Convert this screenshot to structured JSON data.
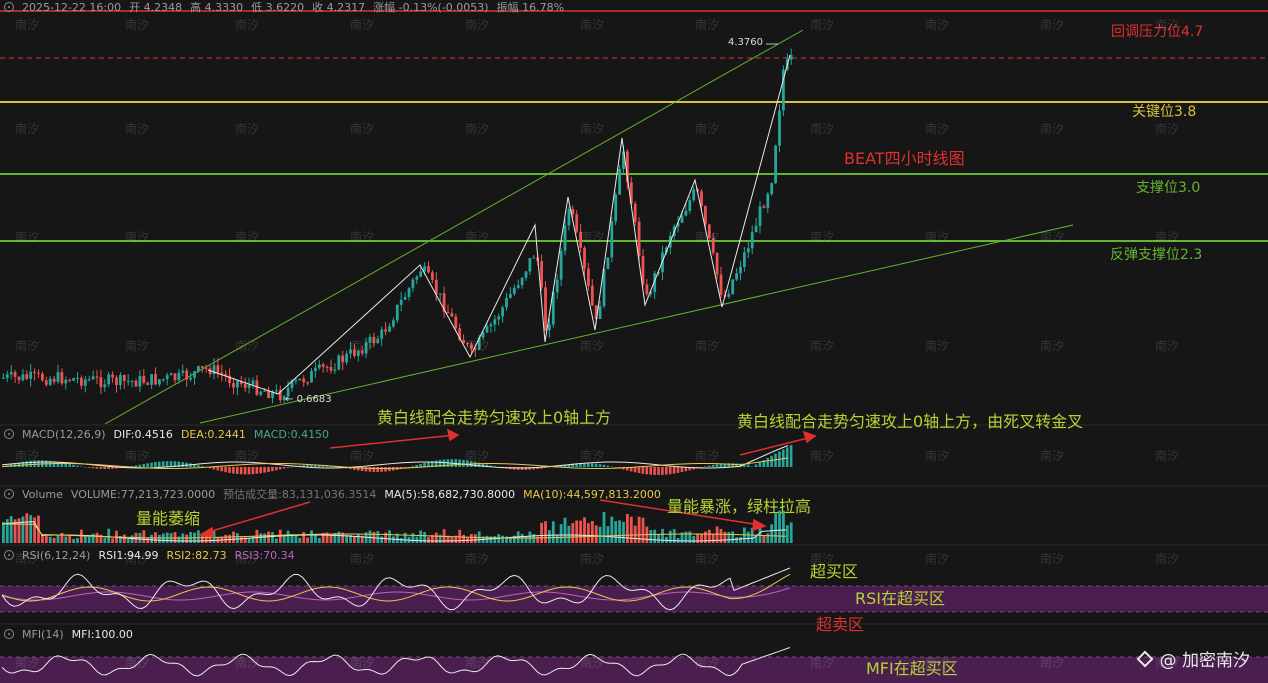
{
  "header": {
    "date": "2025-12-22 16:00",
    "open": "开 4.2348",
    "high": "高 4.3330",
    "low": "低 3.6220",
    "close": "收 4.2317",
    "change": "涨幅 -0.13%(-0.0053)",
    "amplitude": "振幅 16.78%"
  },
  "levels": {
    "resistance": "回调压力位4.7",
    "key": "关键位3.8",
    "chart_title": "BEAT四小时线图",
    "support": "支撑位3.0",
    "rebound": "反弹支撑位2.3"
  },
  "price_labels": {
    "high_mark": "4.3760",
    "low_mark": "0.6683"
  },
  "macd": {
    "name": "MACD(12,26,9)",
    "dif": "DIF:0.4516",
    "dea": "DEA:0.2441",
    "macd": "MACD:0.4150",
    "ann1": "黄白线配合走势匀速攻上0轴上方",
    "ann2": "黄白线配合走势匀速攻上0轴上方，由死叉转金叉"
  },
  "volume": {
    "name": "Volume",
    "volume": "VOLUME:77,213,723.0000",
    "est": "预估成交量:83,131,036.3514",
    "ma5": "MA(5):58,682,730.8000",
    "ma10": "MA(10):44,597,813.2000",
    "ann1": "量能萎缩",
    "ann2": "量能暴涨，绿柱拉高"
  },
  "rsi": {
    "name": "RSI(6,12,24)",
    "rsi1": "RSI1:94.99",
    "rsi2": "RSI2:82.73",
    "rsi3": "RSI3:70.34",
    "ann_overbought": "超买区",
    "ann_in": "RSI在超买区",
    "ann_oversold": "超卖区"
  },
  "mfi": {
    "name": "MFI(14)",
    "value": "MFI:100.00",
    "ann_in": "MFI在超买区"
  },
  "watermark": "南汐",
  "brand": "@ 加密南汐",
  "colors": {
    "up": "#26a69a",
    "down": "#ef5350",
    "key_line": "#d8c23a",
    "support_line": "#63b530",
    "resistance": "#e03030",
    "annotation": "#b5d334",
    "zone": "#4a1f4f"
  }
}
